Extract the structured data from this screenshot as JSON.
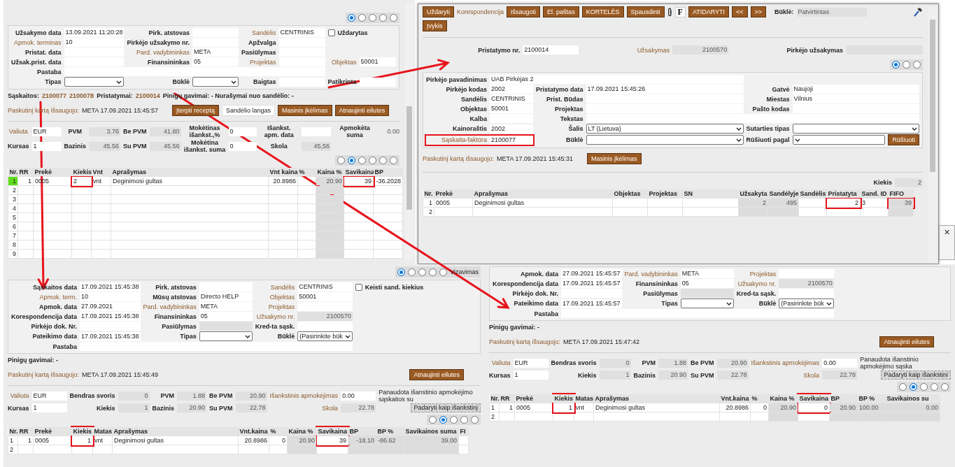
{
  "windows": [
    {
      "kind": "order",
      "sections": [
        {
          "kind": "tabs",
          "tabs": [
            {
              "selected": true
            },
            {
              "selected": false
            },
            {
              "selected": false
            },
            {
              "selected": false
            },
            {
              "selected": false
            }
          ]
        },
        {
          "kind": "form",
          "rows": [
            [
              {
                "kind": "input",
                "label": "Užsakymo data",
                "link": false,
                "value": "13.09.2021 11:20:28"
              },
              {
                "kind": "input",
                "label": "Pirk. atstovas",
                "link": false
              },
              {
                "kind": "input",
                "label": "Sandėlis",
                "link": true,
                "value": "CENTRINIS"
              },
              {
                "kind": "checkbox",
                "label": "Uždarytas",
                "checked": false
              }
            ],
            [
              {
                "kind": "input",
                "label": "Apmok. terminas",
                "link": true,
                "value": "10"
              },
              {
                "kind": "input",
                "label": "Pirkėjo užsakymo nr.",
                "link": false
              },
              {
                "kind": "input",
                "label": "Apžvalga",
                "link": false
              }
            ],
            [
              {
                "kind": "input",
                "label": "Pristat. data",
                "link": false
              },
              {
                "kind": "input",
                "label": "Pard. vadybininkas",
                "link": true,
                "value": "META"
              },
              {
                "kind": "input",
                "label": "Pasiūlymas",
                "link": false
              }
            ],
            [
              {
                "kind": "input",
                "label": "Užsak.prist. data",
                "link": false
              },
              {
                "kind": "input",
                "label": "Finansininkas",
                "link": false,
                "value": "05"
              },
              {
                "kind": "input",
                "label": "Projektas",
                "link": true
              },
              {
                "kind": "input",
                "label": "Objektas",
                "link": true,
                "value": "50001"
              }
            ],
            [
              {
                "kind": "long",
                "label": "Pastaba",
                "link": false
              }
            ],
            [
              {
                "kind": "select",
                "label": "Tipas",
                "link": false
              },
              {
                "kind": "select",
                "label": "Būklė",
                "link": false
              },
              {
                "kind": "input",
                "label": "Baigtas",
                "link": false
              },
              {
                "kind": "input",
                "label": "Patikrinta",
                "link": false
              }
            ]
          ]
        },
        {
          "kind": "line",
          "segments": [
            {
              "kind": "label",
              "text": "Sąskaitos:"
            },
            {
              "kind": "link",
              "text": "2100077"
            },
            {
              "kind": "link",
              "text": "2100078"
            },
            {
              "kind": "label",
              "text": "Pristatymai:"
            },
            {
              "kind": "link",
              "text": "2100014"
            },
            {
              "kind": "label",
              "text": "Pinigų gavimai: - Nurašymai nuo sandėlio: -"
            }
          ]
        },
        {
          "kind": "saved",
          "label": "Paskutinį kartą išsaugojo:",
          "value": "META 17.09.2021 15:45:57",
          "buttons": [
            {
              "kind": "action",
              "label": "Įterpti receptą"
            },
            {
              "kind": "plain",
              "label": "Sandėlio langas"
            },
            {
              "kind": "action",
              "label": "Masinis įkėlimas"
            },
            {
              "kind": "right",
              "label": "Atnaujinti eilutes"
            }
          ]
        },
        {
          "kind": "totals",
          "rows": [
            [
              {
                "kind": "input",
                "label": "Valiuta",
                "link": true,
                "value": "EUR"
              },
              {
                "kind": "readonly",
                "label": "PVM",
                "link": false,
                "value": "3.76"
              },
              {
                "kind": "readonly",
                "label": "Be PVM",
                "link": false,
                "value": "41.80"
              },
              {
                "kind": "input",
                "label": "Mokėtinas išankst.,%",
                "link": false,
                "value": "0"
              },
              {
                "kind": "input",
                "label": "Išankst. apm. data",
                "link": false
              },
              {
                "kind": "plainvalue",
                "label": "Apmokėta suma",
                "link": false,
                "value": "0.00"
              }
            ],
            [
              {
                "kind": "input",
                "label": "Kursas",
                "link": false,
                "value": "1"
              },
              {
                "kind": "readonly",
                "label": "Bazinis",
                "link": false,
                "value": "45.56"
              },
              {
                "kind": "readonly",
                "label": "Su PVM",
                "link": false,
                "value": "45.56"
              },
              {
                "kind": "input",
                "label": "Mokėtina išankst. suma",
                "link": false,
                "value": "0"
              },
              {
                "kind": "readonly",
                "label": "Skola",
                "link": false,
                "value": "45,56"
              }
            ]
          ]
        },
        {
          "kind": "tabs",
          "tabs": [
            {
              "selected": false
            },
            {
              "selected": true
            },
            {
              "selected": false
            },
            {
              "selected": false
            },
            {
              "selected": false
            },
            {
              "selected": false
            }
          ]
        },
        {
          "kind": "grid",
          "columns": [
            {
              "label": "Nr.",
              "readonly": false,
              "marked": false
            },
            {
              "label": "RR",
              "readonly": false,
              "marked": false
            },
            {
              "label": "Prekė",
              "readonly": false,
              "marked": false
            },
            {
              "label": "Kiekis",
              "readonly": false,
              "marked": true
            },
            {
              "label": "Vnt",
              "readonly": false,
              "marked": false
            },
            {
              "label": "Aprašymas",
              "readonly": false,
              "marked": false
            },
            {
              "label": "Vnt kaina",
              "readonly": false,
              "marked": false
            },
            {
              "label": "%",
              "readonly": false,
              "marked": false
            },
            {
              "label": "Kaina %",
              "readonly": true,
              "marked": false
            },
            {
              "label": "Savikaina",
              "readonly": false,
              "marked": true
            },
            {
              "label": "BP",
              "readonly": false,
              "marked": false
            }
          ],
          "rows": [
            {
              "selected": true,
              "cells": [
                "1",
                "1",
                "0005",
                "2",
                "vnt",
                "Deginimosi gultas",
                "20.8986",
                "",
                "20.90",
                "39",
                "-36.2028"
              ]
            },
            {
              "selected": false,
              "cells": [
                "2",
                "",
                "",
                "",
                "",
                "",
                "",
                "",
                "",
                "",
                ""
              ]
            },
            {
              "selected": false,
              "cells": [
                "3",
                "",
                "",
                "",
                "",
                "",
                "",
                "",
                "",
                "",
                ""
              ]
            },
            {
              "selected": false,
              "cells": [
                "4",
                "",
                "",
                "",
                "",
                "",
                "",
                "",
                "",
                "",
                ""
              ]
            },
            {
              "selected": false,
              "cells": [
                "5",
                "",
                "",
                "",
                "",
                "",
                "",
                "",
                "",
                "",
                ""
              ]
            },
            {
              "selected": false,
              "cells": [
                "6",
                "",
                "",
                "",
                "",
                "",
                "",
                "",
                "",
                "",
                ""
              ]
            },
            {
              "selected": false,
              "cells": [
                "7",
                "",
                "",
                "",
                "",
                "",
                "",
                "",
                "",
                "",
                ""
              ]
            },
            {
              "selected": false,
              "cells": [
                "8",
                "",
                "",
                "",
                "",
                "",
                "",
                "",
                "",
                "",
                ""
              ]
            },
            {
              "selected": false,
              "cells": [
                "9",
                "",
                "",
                "",
                "",
                "",
                "",
                "",
                "",
                "",
                ""
              ]
            }
          ]
        }
      ]
    },
    {
      "kind": "delivery",
      "sections": [
        {
          "kind": "toolbar",
          "rows": [
            [
              {
                "kind": "button",
                "label": "Uždaryti"
              },
              {
                "kind": "link",
                "label": "Korespondencija"
              },
              {
                "kind": "button",
                "label": "Išsaugoti"
              },
              {
                "kind": "button",
                "label": "El. paštas"
              },
              {
                "kind": "button",
                "label": "KORTELĖS"
              },
              {
                "kind": "button",
                "label": "Spausdinti"
              },
              {
                "kind": "clip"
              },
              {
                "kind": "letter",
                "label": "F"
              },
              {
                "kind": "button",
                "label": "ATIDARYTI"
              },
              {
                "kind": "button",
                "label": "<<"
              },
              {
                "kind": "button",
                "label": ">>"
              },
              {
                "kind": "status",
                "label": "Būklė:",
                "value": "Patvirtintas"
              },
              {
                "kind": "tool"
              }
            ],
            [
              {
                "kind": "button",
                "label": "Įvykis"
              }
            ]
          ]
        },
        {
          "kind": "head",
          "rows": [
            [
              {
                "kind": "input",
                "label": "Pristatymo nr.",
                "link": false,
                "value": "2100014"
              },
              {
                "kind": "readonly",
                "label": "Užsakymas",
                "link": true,
                "value": "2100570"
              },
              {
                "kind": "readonly",
                "label": "Pirkėjo užsakymas",
                "link": false
              }
            ]
          ]
        },
        {
          "kind": "tabs",
          "tabs": [
            {
              "selected": true
            },
            {
              "selected": false
            },
            {
              "selected": false
            }
          ]
        },
        {
          "kind": "form",
          "rows": [
            [
              {
                "kind": "long",
                "label": "Pirkėjo pavadinimas",
                "link": false,
                "value": "UAB Pirkėjas 2"
              }
            ],
            [
              {
                "kind": "input",
                "label": "Pirkėjo kodas",
                "link": false,
                "value": "2002"
              },
              {
                "kind": "input",
                "label": "Pristatymo data",
                "link": false,
                "value": "17.09.2021 15:45:26"
              },
              {
                "kind": "input",
                "label": "Gatvė",
                "link": false,
                "value": "Naujoji"
              }
            ],
            [
              {
                "kind": "input",
                "label": "Sandėlis",
                "link": false,
                "value": "CENTRINIS"
              },
              {
                "kind": "input",
                "label": "Prist. Būdas",
                "link": false
              },
              {
                "kind": "input",
                "label": "Miestas",
                "link": false,
                "value": "Vilnius"
              }
            ],
            [
              {
                "kind": "input",
                "label": "Objektas",
                "link": false,
                "value": "50001"
              },
              {
                "kind": "input",
                "label": "Projektas",
                "link": false
              },
              {
                "kind": "input",
                "label": "Pašto kodas",
                "link": false
              }
            ],
            [
              {
                "kind": "input",
                "label": "Kalba",
                "link": false
              },
              {
                "kind": "long",
                "label": "Tekstas",
                "link": false
              }
            ],
            [
              {
                "kind": "input",
                "label": "Kainoraštis",
                "link": false,
                "value": "2002"
              },
              {
                "kind": "select",
                "label": "Šalis",
                "link": false,
                "value": "LT (Lietuva)"
              },
              {
                "kind": "select",
                "label": "Sutarties tipas",
                "link": false
              }
            ],
            [
              {
                "kind": "input",
                "label": "Sąskaita-faktūra",
                "link": true,
                "value": "2100077",
                "marked": true
              },
              {
                "kind": "select",
                "label": "Būklė",
                "link": false
              },
              {
                "kind": "select_button",
                "label": "Rūšiuoti pagal",
                "link": false,
                "button": "Rūšiuoti"
              }
            ]
          ]
        },
        {
          "kind": "saved",
          "label": "Paskutinį kartą išsaugojo:",
          "value": "META 17.09.2021 15:45:31",
          "buttons": [
            {
              "kind": "action",
              "label": "Masinis įkėlimas"
            }
          ]
        },
        {
          "kind": "summary",
          "label": "Kiekis",
          "value": "2"
        },
        {
          "kind": "grid",
          "columns": [
            {
              "label": "Nr.",
              "readonly": false,
              "marked": false
            },
            {
              "label": "Prekė",
              "readonly": false,
              "marked": false
            },
            {
              "label": "Aprašymas",
              "readonly": false,
              "marked": false
            },
            {
              "label": "Objektas",
              "readonly": false,
              "marked": false
            },
            {
              "label": "Projektas",
              "readonly": false,
              "marked": false
            },
            {
              "label": "SN",
              "readonly": false,
              "marked": false
            },
            {
              "label": "Užsakyta",
              "readonly": true,
              "marked": false
            },
            {
              "label": "Sandėlyje",
              "readonly": true,
              "marked": false
            },
            {
              "label": "Sandėlis",
              "readonly": false,
              "marked": false
            },
            {
              "label": "Pristatyta",
              "readonly": false,
              "marked": true
            },
            {
              "label": "Sand. ID",
              "readonly": false,
              "marked": false
            },
            {
              "label": "FIFO",
              "readonly": true,
              "marked": true
            }
          ],
          "rows": [
            {
              "selected": false,
              "cells": [
                "1",
                "0005",
                "Deginimosi gultas",
                "",
                "",
                "",
                "2",
                "495",
                "",
                "2",
                "3",
                "39"
              ]
            },
            {
              "selected": false,
              "cells": [
                "2",
                "",
                "",
                "",
                "",
                "",
                "",
                "",
                "",
                "",
                "",
                ""
              ]
            }
          ]
        }
      ]
    },
    {
      "kind": "fragment",
      "sections": [
        {
          "kind": "close",
          "label": "×"
        }
      ]
    },
    {
      "kind": "invoice",
      "sections": [
        {
          "kind": "tabs",
          "tabs": [
            {
              "selected": true
            },
            {
              "selected": false
            },
            {
              "selected": false
            },
            {
              "selected": false
            },
            {
              "selected": false,
              "label": "Vizavimas"
            }
          ]
        },
        {
          "kind": "form",
          "rows": [
            [
              {
                "kind": "input",
                "label": "Sąskaitos data",
                "link": false,
                "value": "17.09.2021 15:45:38"
              },
              {
                "kind": "input",
                "label": "Pirk. atstovas",
                "link": false
              },
              {
                "kind": "input",
                "label": "Sandėlis",
                "link": true,
                "value": "CENTRINIS"
              },
              {
                "kind": "checkbox",
                "label": "Keisti sand. kiekius",
                "checked": false
              }
            ],
            [
              {
                "kind": "input",
                "label": "Apmok. term.",
                "link": true,
                "value": "10"
              },
              {
                "kind": "input",
                "label": "Mūsų atstovas",
                "link": false,
                "value": "Directo HELP"
              },
              {
                "kind": "input",
                "label": "Objektas",
                "link": true,
                "value": "50001"
              }
            ],
            [
              {
                "kind": "input",
                "label": "Apmok. data",
                "link": false,
                "value": "27.09.2021"
              },
              {
                "kind": "input",
                "label": "Pard. vadybininkas",
                "link": true,
                "value": "META"
              },
              {
                "kind": "input",
                "label": "Projektas",
                "link": true
              }
            ],
            [
              {
                "kind": "input",
                "label": "Korespondencija data",
                "link": false,
                "value": "17.09.2021 15:45:38"
              },
              {
                "kind": "input",
                "label": "Finansininkas",
                "link": false,
                "value": "05"
              },
              {
                "kind": "readonly",
                "label": "Užsakymo nr.",
                "link": true,
                "value": "2100570"
              }
            ],
            [
              {
                "kind": "input",
                "label": "Pirkėjo dok. Nr.",
                "link": false
              },
              {
                "kind": "readonly",
                "label": "Pasiūlymas",
                "link": false
              },
              {
                "kind": "input",
                "label": "Kred-ta sąsk.",
                "link": false
              }
            ],
            [
              {
                "kind": "input",
                "label": "Pateikimo data",
                "link": false,
                "value": "17.09.2021 15:45:38"
              },
              {
                "kind": "select",
                "label": "Tipas",
                "link": false
              },
              {
                "kind": "select",
                "label": "Būklė",
                "link": false,
                "value": "(Pasirinkite būk"
              }
            ],
            [
              {
                "kind": "long",
                "label": "Pastaba",
                "link": false
              }
            ]
          ]
        },
        {
          "kind": "note",
          "text": "Pinigų gavimai: -"
        },
        {
          "kind": "saved",
          "label": "Paskutinį kartą išsaugojo:",
          "value": "META 17.09.2021 15:45:49",
          "buttons": [
            {
              "kind": "right",
              "label": "Atnaujinti eilutes"
            }
          ]
        },
        {
          "kind": "totals",
          "rows": [
            [
              {
                "kind": "input",
                "label": "Valiuta",
                "link": true,
                "value": "EUR"
              },
              {
                "kind": "readonly",
                "label": "Bendras svoris",
                "link": false,
                "value": "0"
              },
              {
                "kind": "readonly",
                "label": "PVM",
                "link": false,
                "value": "1.88"
              },
              {
                "kind": "readonly",
                "label": "Be PVM",
                "link": false,
                "value": "20.90"
              },
              {
                "kind": "input",
                "label": "Išankstinis apmokėjimas",
                "link": true,
                "value": "0.00"
              },
              {
                "kind": "text",
                "label": "Panaudota išanstinio apmokėjimo sąskaitos su"
              }
            ],
            [
              {
                "kind": "input",
                "label": "Kursas",
                "link": false,
                "value": "1"
              },
              {
                "kind": "readonly",
                "label": "Kiekis",
                "link": false,
                "value": "1"
              },
              {
                "kind": "readonly",
                "label": "Bazinis",
                "link": false,
                "value": "20.90"
              },
              {
                "kind": "readonly",
                "label": "Su PVM",
                "link": false,
                "value": "22.78"
              },
              {
                "kind": "readonly",
                "label": "Skola",
                "link": true,
                "value": "22.78"
              },
              {
                "kind": "button",
                "label": "Padaryti kaip išankstinį"
              }
            ]
          ]
        },
        {
          "kind": "tabs",
          "tabs": [
            {
              "selected": false
            },
            {
              "selected": true
            },
            {
              "selected": false
            },
            {
              "selected": false
            },
            {
              "selected": false
            }
          ]
        },
        {
          "kind": "grid",
          "columns": [
            {
              "label": "Nr.",
              "readonly": false,
              "marked": false
            },
            {
              "label": "RR",
              "readonly": false,
              "marked": false
            },
            {
              "label": "Prekė",
              "readonly": false,
              "marked": false
            },
            {
              "label": "Kiekis",
              "readonly": false,
              "marked": true
            },
            {
              "label": "Matas",
              "readonly": false,
              "marked": false
            },
            {
              "label": "Aprašymas",
              "readonly": false,
              "marked": false
            },
            {
              "label": "Vnt.kaina",
              "readonly": false,
              "marked": false
            },
            {
              "label": "%",
              "readonly": false,
              "marked": false
            },
            {
              "label": "Kaina %",
              "readonly": true,
              "marked": false
            },
            {
              "label": "Savikaina",
              "readonly": false,
              "marked": true
            },
            {
              "label": "BP",
              "readonly": true,
              "marked": false
            },
            {
              "label": "BP %",
              "readonly": true,
              "marked": false
            },
            {
              "label": "Savikainos suma",
              "readonly": true,
              "marked": false
            },
            {
              "label": "FI",
              "readonly": false,
              "marked": false
            }
          ],
          "rows": [
            {
              "selected": false,
              "cells": [
                "1",
                "1",
                "0005",
                "1",
                "vnt",
                "Deginimosi gultas",
                "20.8986",
                "0",
                "20.90",
                "39",
                "-18.10",
                "-86.62",
                "39.00",
                ""
              ]
            },
            {
              "selected": false,
              "cells": [
                "2",
                "",
                "",
                "",
                "",
                "",
                "",
                "",
                "",
                "",
                "",
                "",
                "",
                ""
              ]
            }
          ]
        }
      ]
    },
    {
      "kind": "invoice",
      "sections": [
        {
          "kind": "form",
          "rows": [
            [
              {
                "kind": "input",
                "label": "Apmok. data",
                "link": false,
                "value": "27.09.2021 15:45:57"
              },
              {
                "kind": "input",
                "label": "Pard. vadybininkas",
                "link": true,
                "value": "META"
              },
              {
                "kind": "input",
                "label": "Projektas",
                "link": true
              }
            ],
            [
              {
                "kind": "input",
                "label": "Korespondencija data",
                "link": false,
                "value": "17.09.2021 15:45:57"
              },
              {
                "kind": "input",
                "label": "Finansininkas",
                "link": false,
                "value": "05"
              },
              {
                "kind": "readonly",
                "label": "Užsakymo nr.",
                "link": true,
                "value": "2100570"
              }
            ],
            [
              {
                "kind": "input",
                "label": "Pirkėjo dok. Nr.",
                "link": false
              },
              {
                "kind": "readonly",
                "label": "Pasiūlymas",
                "link": false
              },
              {
                "kind": "input",
                "label": "Kred-ta sąsk.",
                "link": false
              }
            ],
            [
              {
                "kind": "input",
                "label": "Pateikimo data",
                "link": false,
                "value": "17.09.2021 15:45:57"
              },
              {
                "kind": "select",
                "label": "Tipas",
                "link": false
              },
              {
                "kind": "select",
                "label": "Būklė",
                "link": false,
                "value": "(Pasirinkite būk"
              }
            ],
            [
              {
                "kind": "long",
                "label": "Pastaba",
                "link": false
              }
            ]
          ]
        },
        {
          "kind": "note",
          "text": "Pinigų gavimai: -"
        },
        {
          "kind": "saved",
          "label": "Paskutinį kartą išsaugojo:",
          "value": "META 17.09.2021 15:47:42",
          "buttons": [
            {
              "kind": "right",
              "label": "Atnaujinti eilutes"
            }
          ]
        },
        {
          "kind": "totals",
          "rows": [
            [
              {
                "kind": "input",
                "label": "Valiuta",
                "link": true,
                "value": "EUR"
              },
              {
                "kind": "readonly",
                "label": "Bendras svoris",
                "link": false,
                "value": "0"
              },
              {
                "kind": "readonly",
                "label": "PVM",
                "link": false,
                "value": "1.88"
              },
              {
                "kind": "readonly",
                "label": "Be PVM",
                "link": false,
                "value": "20.90"
              },
              {
                "kind": "input",
                "label": "Išankstinis apmokėjimas",
                "link": true,
                "value": "0.00"
              },
              {
                "kind": "text",
                "label": "Panaudota išanstinio apmokėjimo sąska"
              }
            ],
            [
              {
                "kind": "input",
                "label": "Kursas",
                "link": false,
                "value": "1"
              },
              {
                "kind": "readonly",
                "label": "Kiekis",
                "link": false,
                "value": "1"
              },
              {
                "kind": "readonly",
                "label": "Bazinis",
                "link": false,
                "value": "20.90"
              },
              {
                "kind": "readonly",
                "label": "Su PVM",
                "link": false,
                "value": "22.78"
              },
              {
                "kind": "readonly",
                "label": "Skola",
                "link": true,
                "value": "22.78"
              },
              {
                "kind": "button",
                "label": "Padaryti kaip išankstini"
              }
            ]
          ]
        },
        {
          "kind": "tabs",
          "tabs": [
            {
              "selected": false
            },
            {
              "selected": true
            },
            {
              "selected": false
            },
            {
              "selected": false
            },
            {
              "selected": false
            }
          ]
        },
        {
          "kind": "grid",
          "columns": [
            {
              "label": "Nr.",
              "readonly": false,
              "marked": false
            },
            {
              "label": "RR",
              "readonly": false,
              "marked": false
            },
            {
              "label": "Prekė",
              "readonly": false,
              "marked": false
            },
            {
              "label": "Kiekis",
              "readonly": false,
              "marked": true
            },
            {
              "label": "Matas",
              "readonly": false,
              "marked": false
            },
            {
              "label": "Aprašymas",
              "readonly": false,
              "marked": false
            },
            {
              "label": "Vnt.kaina",
              "readonly": false,
              "marked": false
            },
            {
              "label": "%",
              "readonly": false,
              "marked": false
            },
            {
              "label": "Kaina %",
              "readonly": true,
              "marked": false
            },
            {
              "label": "Savikaina",
              "readonly": false,
              "marked": true
            },
            {
              "label": "BP",
              "readonly": true,
              "marked": false
            },
            {
              "label": "BP %",
              "readonly": true,
              "marked": false
            },
            {
              "label": "Savikainos su",
              "readonly": true,
              "marked": false
            }
          ],
          "rows": [
            {
              "selected": false,
              "cells": [
                "1",
                "1",
                "0005",
                "1",
                "vnt",
                "Deginimosi gultas",
                "20.8986",
                "0",
                "20.90",
                "0",
                "20.90",
                "100.00",
                "0.00"
              ]
            },
            {
              "selected": false,
              "cells": [
                "2",
                "",
                "",
                "",
                "",
                "",
                "",
                "",
                "",
                "",
                "",
                "",
                ""
              ]
            }
          ]
        }
      ]
    }
  ]
}
